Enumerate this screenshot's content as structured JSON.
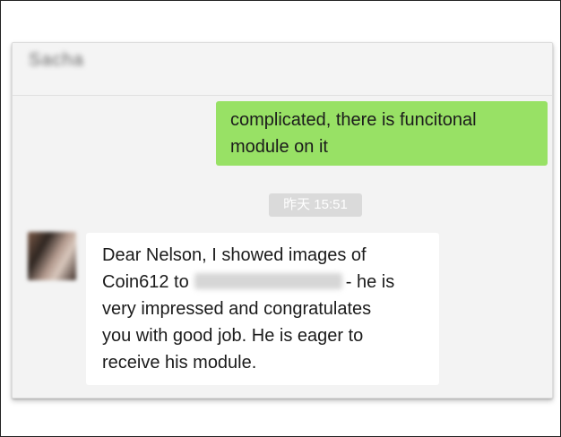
{
  "chat": {
    "contact_name": "Sacha",
    "outgoing_message": {
      "lines": [
        "complicated, there is funcitonal",
        "module on it"
      ]
    },
    "timestamp": "昨天 15:51",
    "incoming_message": {
      "line1": "Dear Nelson, I showed images of",
      "line2_before": "Coin612 to",
      "line2_after": "- he is",
      "line3": "very impressed and congratulates",
      "line4": "you with good job. He is eager to",
      "line5": "receive his module."
    }
  },
  "colors": {
    "outgoing_bubble": "#98e165",
    "incoming_bubble": "#ffffff",
    "chat_background": "#f3f3f3",
    "timestamp_background": "#dadada"
  }
}
